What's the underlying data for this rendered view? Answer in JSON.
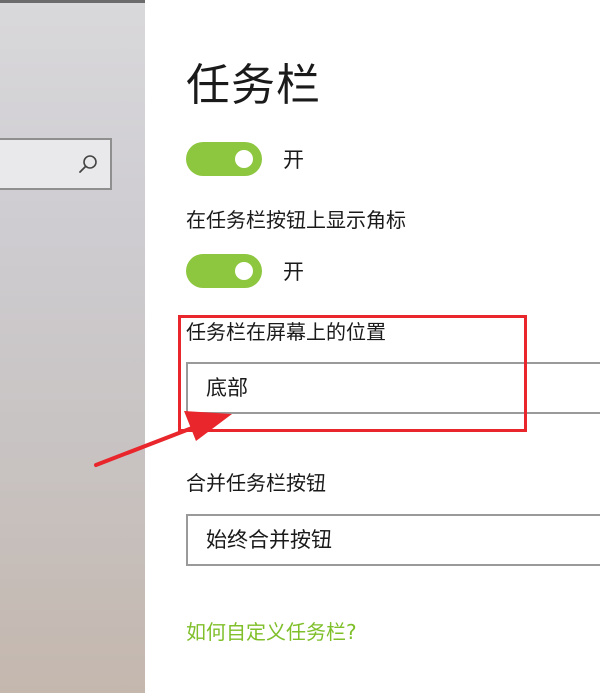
{
  "settings": {
    "title": "任务栏",
    "toggle1": {
      "state_label": "开",
      "on": true
    },
    "badge_setting": {
      "label": "在任务栏按钮上显示角标",
      "state_label": "开",
      "on": true
    },
    "position_setting": {
      "label": "任务栏在屏幕上的位置",
      "selected": "底部"
    },
    "combine_setting": {
      "label": "合并任务栏按钮",
      "selected": "始终合并按钮"
    },
    "help_link": "如何自定义任务栏?"
  },
  "colors": {
    "accent": "#8dc63f",
    "link": "#7fbf2a",
    "annotation": "#e8262c"
  },
  "icons": {
    "search": "search-icon",
    "arrow": "red-arrow-annotation"
  }
}
